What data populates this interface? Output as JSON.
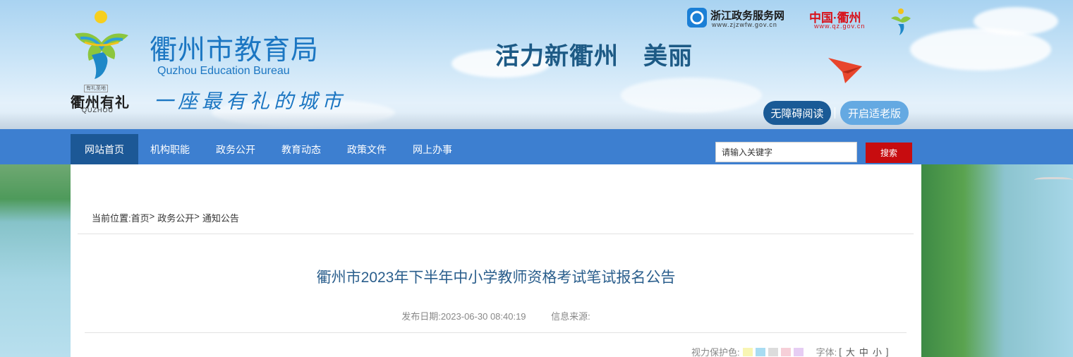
{
  "header": {
    "site_name": "衢州市教育局",
    "site_name_en": "Quzhou Education Bureau",
    "slogan": "一座最有礼的城市",
    "emblem_cn": "衢州有礼",
    "emblem_small": "有礼圣地",
    "emblem_en": "QUZHOU",
    "banner_text": "活力新衢州　美丽",
    "zjzw_title": "浙江政务服务网",
    "zjzw_url": "www.zjzwfw.gov.cn",
    "qz_title": "中国·衢州",
    "qz_url": "www.qz.gov.cn",
    "accessibility_btn": "无障碍阅读",
    "elder_btn": "开启适老版"
  },
  "nav": {
    "items": [
      "网站首页",
      "机构职能",
      "政务公开",
      "教育动态",
      "政策文件",
      "网上办事"
    ],
    "search_placeholder": "请输入关键字",
    "search_btn": "搜索"
  },
  "breadcrumb": {
    "label": "当前位置:",
    "items": [
      "首页",
      "政务公开",
      "通知公告"
    ],
    "separator": ">"
  },
  "article": {
    "title": "衢州市2023年下半年中小学教师资格考试笔试报名公告",
    "publish_label": "发布日期:",
    "publish_date": "2023-06-30 08:40:19",
    "source_label": "信息来源:",
    "source_value": ""
  },
  "tools": {
    "eye_label": "视力保护色:",
    "swatches": [
      "#f8f5b3",
      "#a8dcf2",
      "#dcdcdc",
      "#f6cfd8",
      "#e6cdf3"
    ],
    "font_label": "字体:",
    "font_open": "[",
    "font_sizes": [
      "大",
      "中",
      "小"
    ],
    "font_close": "]"
  },
  "colors": {
    "nav_bg": "#3d7fd0",
    "nav_active": "#1c5896",
    "search_btn": "#c70c0f",
    "title": "#2a5e8c",
    "brand_blue": "#1b76c2"
  }
}
